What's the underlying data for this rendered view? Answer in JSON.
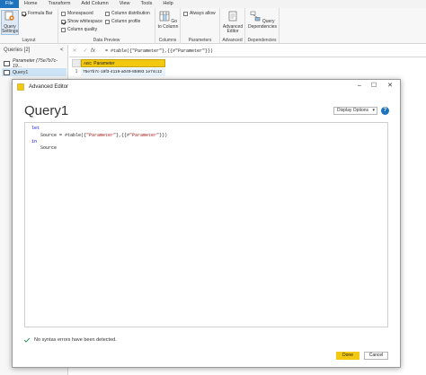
{
  "menu": {
    "tabs": [
      "File",
      "Home",
      "Transform",
      "Add Column",
      "View",
      "Tools",
      "Help"
    ]
  },
  "ribbon": {
    "query_settings": "Query Settings",
    "formula_bar": "Formula Bar",
    "monospaced": "Monospaced",
    "show_whitespace": "Show whitespace",
    "column_quality": "Column quality",
    "column_distribution": "Column distribution",
    "column_profile": "Column profile",
    "always_allow": "Always allow",
    "go_to_column": "Go to Column",
    "advanced_editor": "Advanced Editor",
    "query_dependencies": "Query Dependencies",
    "groups": {
      "layout": "Layout",
      "data_preview": "Data Preview",
      "columns": "Columns",
      "parameters": "Parameters",
      "advanced": "Advanced",
      "dependencies": "Dependencies"
    }
  },
  "queries": {
    "header": "Queries [2]",
    "collapse": "<",
    "items": [
      {
        "label": "Parameter (75e7b7c-19..."
      },
      {
        "label": "Query1"
      }
    ]
  },
  "formula_bar": {
    "fx": "fx",
    "text": "= #table({\"Parameter\"},{{#\"Parameter\"}})"
  },
  "grid": {
    "column": "Parameter",
    "row_number": "1",
    "cell": "75e7b7c-19f3-4119-a049-85993 1e74c12"
  },
  "dialog": {
    "title": "Advanced Editor",
    "heading": "Query1",
    "display_options": "Display Options",
    "help": "?",
    "code": {
      "let": "let",
      "source_prefix": "Source = #table({",
      "str1": "\"Parameter\"",
      "mid": "},{{#",
      "str2": "\"Parameter\"",
      "suffix": "}})",
      "in": "in",
      "source": "Source"
    },
    "status": "No syntax errors have been detected.",
    "done": "Done",
    "cancel": "Cancel"
  }
}
